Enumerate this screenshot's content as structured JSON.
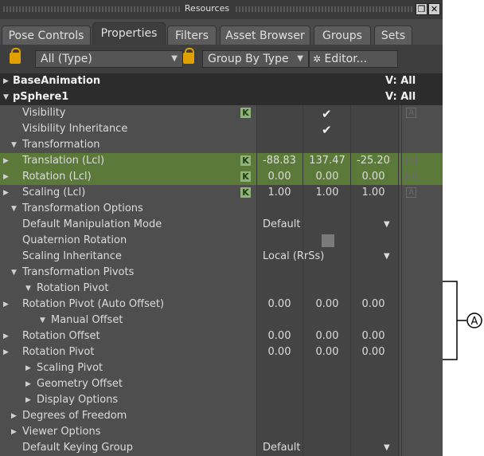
{
  "window": {
    "title": "Resources"
  },
  "tabs": [
    "Pose Controls",
    "Properties",
    "Filters",
    "Asset Browser",
    "Groups",
    "Sets"
  ],
  "toolbar": {
    "type_filter": "All (Type)",
    "group_by": "Group By Type",
    "editor": "Editor..."
  },
  "rows": [
    {
      "label": "BaseAnimation",
      "hdr": true,
      "vis": "V: All",
      "tri": "▶",
      "indent": 0
    },
    {
      "label": "pSphere1",
      "hdr": true,
      "vis": "V: All",
      "tri": "▼",
      "indent": 0
    },
    {
      "label": "Visibility",
      "key": "K",
      "check": true,
      "anim": "A",
      "indent": 0
    },
    {
      "label": "Visibility Inheritance",
      "check": true,
      "indent": 0
    },
    {
      "label": "Transformation",
      "tri": "▼",
      "indent": 1
    },
    {
      "label": "Translation (Lcl)",
      "tri": "▶",
      "key": "K",
      "values": [
        "-88.83",
        "137.47",
        "-25.20"
      ],
      "anim": "A",
      "green": true,
      "indent": 0
    },
    {
      "label": "Rotation (Lcl)",
      "tri": "▶",
      "key": "K",
      "values": [
        "0.00",
        "0.00",
        "0.00"
      ],
      "anim": "A",
      "green": true,
      "indent": 0
    },
    {
      "label": "Scaling (Lcl)",
      "tri": "▶",
      "key": "K",
      "values": [
        "1.00",
        "1.00",
        "1.00"
      ],
      "anim": "A",
      "indent": 0
    },
    {
      "label": "Transformation Options",
      "tri": "▼",
      "indent": 1
    },
    {
      "label": "Default Manipulation Mode",
      "dropdown": "Default",
      "indent": 0
    },
    {
      "label": "Quaternion Rotation",
      "uncheck": true,
      "indent": 0
    },
    {
      "label": "Scaling Inheritance",
      "dropdown": "Local (RrSs)",
      "indent": 0
    },
    {
      "label": "Transformation Pivots",
      "tri": "▼",
      "indent": 1
    },
    {
      "label": "Rotation Pivot",
      "tri": "▼",
      "indent": 2
    },
    {
      "label": "Rotation Pivot (Auto Offset)",
      "tri": "▶",
      "values": [
        "0.00",
        "0.00",
        "0.00"
      ],
      "indent": 0
    },
    {
      "label": "Manual Offset",
      "tri": "▼",
      "indent": 3
    },
    {
      "label": "Rotation Offset",
      "tri": "▶",
      "values": [
        "0.00",
        "0.00",
        "0.00"
      ],
      "indent": 0
    },
    {
      "label": "Rotation Pivot",
      "tri": "▶",
      "values": [
        "0.00",
        "0.00",
        "0.00"
      ],
      "indent": 0
    },
    {
      "label": "Scaling Pivot",
      "tri": "▶",
      "indent": 2
    },
    {
      "label": "Geometry Offset",
      "tri": "▶",
      "indent": 2
    },
    {
      "label": "Display Options",
      "tri": "▶",
      "indent": 2
    },
    {
      "label": "Degrees of Freedom",
      "tri": "▶",
      "indent": 1
    },
    {
      "label": "Viewer Options",
      "tri": "▶",
      "indent": 1
    },
    {
      "label": "Default Keying Group",
      "dropdown": "Default",
      "indent": 0
    }
  ],
  "callout": {
    "label": "A"
  }
}
